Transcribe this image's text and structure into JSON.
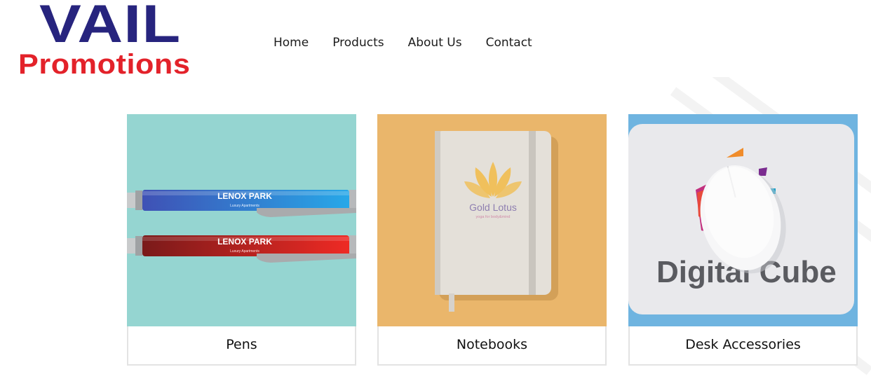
{
  "logo": {
    "line1": "VAIL",
    "line2": "Promotions"
  },
  "nav": {
    "items": [
      {
        "label": "Home"
      },
      {
        "label": "Products"
      },
      {
        "label": "About Us"
      },
      {
        "label": "Contact"
      }
    ]
  },
  "categories": [
    {
      "label": "Pens",
      "image_text": [
        "LENOX PARK",
        "Luxury Apartments",
        "LENOX PARK",
        "Luxury Apartments"
      ]
    },
    {
      "label": "Notebooks",
      "image_text": [
        "Gold Lotus",
        "yoga for body&mind"
      ]
    },
    {
      "label": "Desk Accessories",
      "image_text": [
        "Digital Cube"
      ]
    }
  ],
  "colors": {
    "brand_navy": "#27247e",
    "brand_red": "#e3222a",
    "pens_bg": "#95d5d1",
    "notebook_bg": "#eab66b",
    "desk_bg": "#6fb4e0"
  }
}
